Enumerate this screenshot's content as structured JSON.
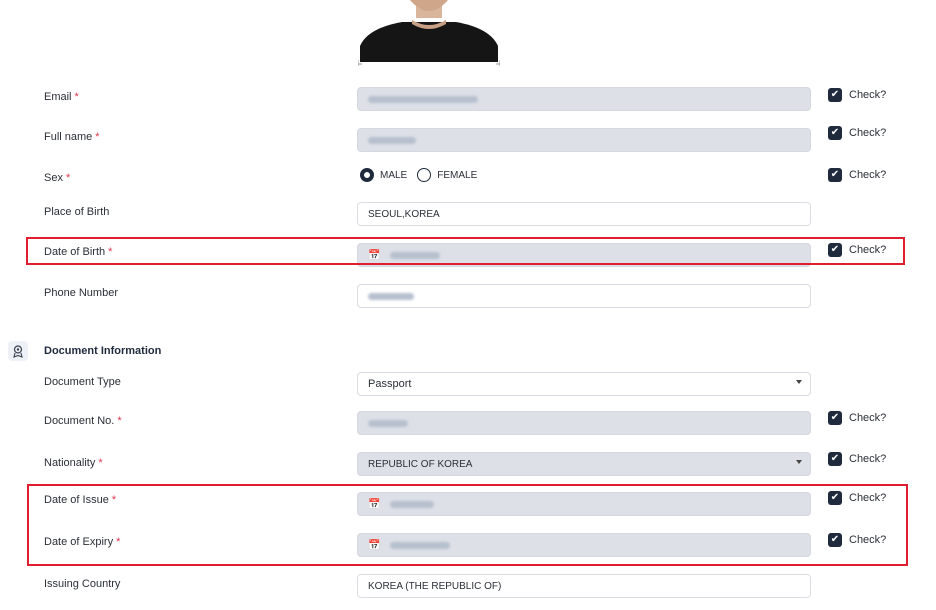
{
  "form": {
    "check_label": "Check?",
    "fields": {
      "email": {
        "label": "Email"
      },
      "full_name": {
        "label": "Full name"
      },
      "sex": {
        "label": "Sex",
        "options": [
          "MALE",
          "FEMALE"
        ],
        "selected": "MALE"
      },
      "place_of_birth": {
        "label": "Place of Birth",
        "value": "SEOUL,KOREA"
      },
      "date_of_birth": {
        "label": "Date of Birth"
      },
      "phone_number": {
        "label": "Phone Number"
      }
    }
  },
  "document_section": {
    "title": "Document Information",
    "fields": {
      "document_type": {
        "label": "Document Type",
        "value": "Passport"
      },
      "document_no": {
        "label": "Document No."
      },
      "nationality": {
        "label": "Nationality",
        "value": "REPUBLIC OF KOREA"
      },
      "date_of_issue": {
        "label": "Date of Issue"
      },
      "date_of_expiry": {
        "label": "Date of Expiry"
      },
      "issuing_country": {
        "label": "Issuing Country",
        "value": "KOREA (THE REPUBLIC OF)"
      }
    }
  },
  "required_marker": "*",
  "colors": {
    "accent": "#1f2b3d",
    "required": "#e0364c",
    "highlight": "#e01e2f",
    "locked_field": "#dde0e6"
  },
  "icons": {
    "calendar": "calendar-icon",
    "check": "checkmark-icon",
    "section": "id-badge-icon"
  }
}
